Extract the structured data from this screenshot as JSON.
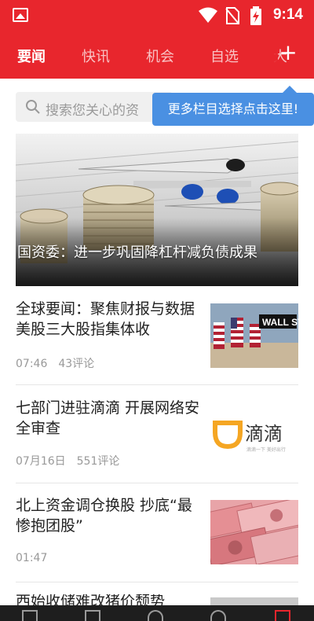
{
  "status_bar": {
    "time": "9:14"
  },
  "tabs": [
    {
      "label": "要闻",
      "active": true
    },
    {
      "label": "快讯",
      "active": false
    },
    {
      "label": "机会",
      "active": false
    },
    {
      "label": "自选",
      "active": false
    },
    {
      "label": "大",
      "active": false
    }
  ],
  "search": {
    "placeholder": "搜索您关心的资"
  },
  "tooltip": {
    "text": "更多栏目选择点击这里!"
  },
  "hero": {
    "title": "国资委：进一步巩固降杠杆减负债成果"
  },
  "news": [
    {
      "title": "全球要闻：聚焦财报与数据 美股三大股指集体收",
      "time": "07:46",
      "comments": "43评论",
      "thumb_text": "WALL ST"
    },
    {
      "title": "七部门进驻滴滴 开展网络安全审查",
      "time": "07月16日",
      "comments": "551评论",
      "thumb_text": "滴滴",
      "thumb_subtext": "滴滴一下 美好出行"
    },
    {
      "title": "北上资金调仓换股 抄底“最惨抱团股”",
      "time": "01:47",
      "comments": ""
    },
    {
      "title": "西始收储难改猪价颓势"
    }
  ],
  "colors": {
    "brand_red": "#e8262d",
    "tooltip_blue": "#4a90e2"
  }
}
